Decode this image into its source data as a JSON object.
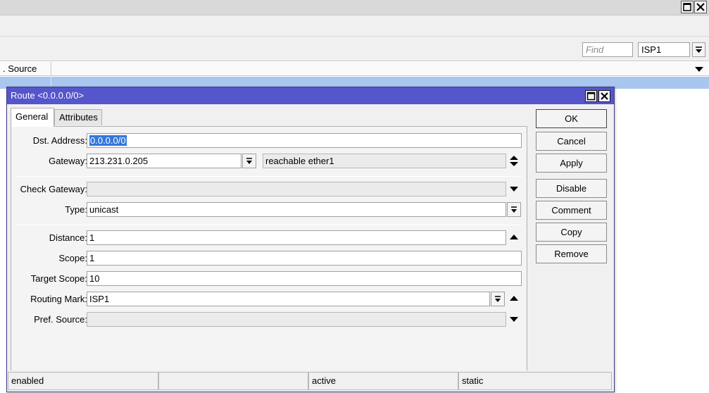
{
  "background": {
    "find_placeholder": "Find",
    "filter_value": "ISP1",
    "column_header": ". Source"
  },
  "dialog": {
    "title": "Route <0.0.0.0/0>",
    "tabs": {
      "general": "General",
      "attributes": "Attributes"
    },
    "fields": {
      "dst_address": {
        "label": "Dst. Address:",
        "value": "0.0.0.0/0"
      },
      "gateway": {
        "label": "Gateway:",
        "value": "213.231.0.205",
        "status": "reachable ether1"
      },
      "check_gateway": {
        "label": "Check Gateway:",
        "value": ""
      },
      "type": {
        "label": "Type:",
        "value": "unicast"
      },
      "distance": {
        "label": "Distance:",
        "value": "1"
      },
      "scope": {
        "label": "Scope:",
        "value": "1"
      },
      "target_scope": {
        "label": "Target Scope:",
        "value": "10"
      },
      "routing_mark": {
        "label": "Routing Mark:",
        "value": "ISP1"
      },
      "pref_source": {
        "label": "Pref. Source:",
        "value": ""
      }
    },
    "buttons": {
      "ok": "OK",
      "cancel": "Cancel",
      "apply": "Apply",
      "disable": "Disable",
      "comment": "Comment",
      "copy": "Copy",
      "remove": "Remove"
    },
    "status": {
      "state": "enabled",
      "empty": "",
      "active": "active",
      "static": "static"
    }
  },
  "colors": {
    "titlebar": "#5555cc",
    "selected_row": "#a9c6ee",
    "text_selection": "#3377dd"
  }
}
